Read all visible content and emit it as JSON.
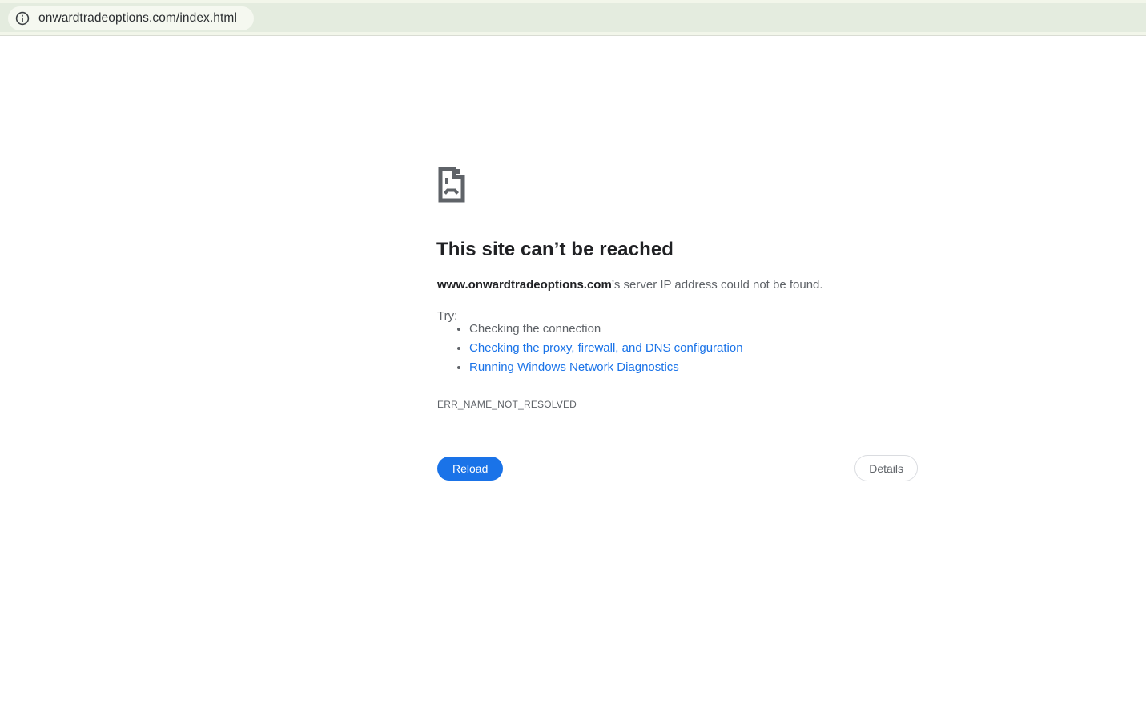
{
  "toolbar": {
    "url": "onwardtradeoptions.com/index.html",
    "info_icon": "info-icon"
  },
  "error": {
    "title": "This site can’t be reached",
    "domain": "www.onwardtradeoptions.com",
    "message": "’s server IP address could not be found.",
    "try_label": "Try:",
    "suggestions": [
      {
        "label": "Checking the connection",
        "link": false
      },
      {
        "label": "Checking the proxy, firewall, and DNS configuration",
        "link": true
      },
      {
        "label": "Running Windows Network Diagnostics",
        "link": true
      }
    ],
    "code": "ERR_NAME_NOT_RESOLVED",
    "reload_label": "Reload",
    "details_label": "Details"
  },
  "colors": {
    "accent_blue": "#1a73e8",
    "link_blue": "#1a73e8",
    "toolbar_green": "#e4ecdf",
    "omnibox_bg": "#f5f8f0",
    "text_dark": "#202124",
    "text_gray": "#5f6368",
    "icon_gray": "#5f6368"
  }
}
